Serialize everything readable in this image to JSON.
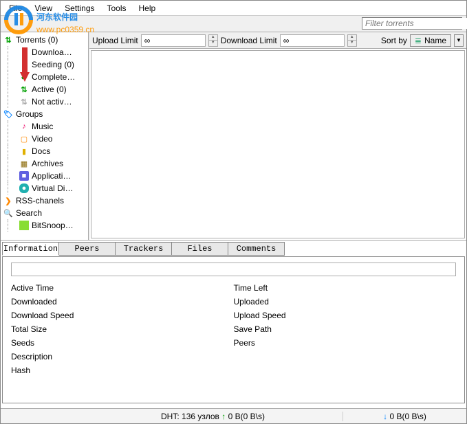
{
  "menu": {
    "file": "File",
    "view": "View",
    "settings": "Settings",
    "tools": "Tools",
    "help": "Help"
  },
  "search": {
    "placeholder": "Filter torrents"
  },
  "limits": {
    "upload_label": "Upload Limit",
    "upload_value": "∞",
    "download_label": "Download Limit",
    "download_value": "∞",
    "sort_label": "Sort by",
    "sort_value": "Name"
  },
  "sidebar": {
    "torrents": {
      "label": "Torrents (0)"
    },
    "torrents_children": [
      {
        "label": "Downloa…",
        "icon": "download"
      },
      {
        "label": "Seeding (0)",
        "icon": "seed"
      },
      {
        "label": "Complete…",
        "icon": "check"
      },
      {
        "label": "Active (0)",
        "icon": "active"
      },
      {
        "label": "Not activ…",
        "icon": "inactive"
      }
    ],
    "groups": {
      "label": "Groups"
    },
    "groups_children": [
      {
        "label": "Music",
        "icon": "music"
      },
      {
        "label": "Video",
        "icon": "video"
      },
      {
        "label": "Docs",
        "icon": "docs"
      },
      {
        "label": "Archives",
        "icon": "archive"
      },
      {
        "label": "Applicati…",
        "icon": "app"
      },
      {
        "label": "Virtual Di…",
        "icon": "disc"
      }
    ],
    "rss": {
      "label": "RSS-chanels"
    },
    "search": {
      "label": "Search"
    },
    "search_children": [
      {
        "label": "BitSnoop…",
        "icon": "site"
      }
    ]
  },
  "tabs": {
    "information": "Information",
    "peers": "Peers",
    "trackers": "Trackers",
    "files": "Files",
    "comments": "Comments"
  },
  "info": {
    "left": [
      "Active Time",
      "Downloaded",
      "Download Speed",
      "Total Size",
      "Seeds",
      "Description",
      "Hash"
    ],
    "right": [
      "Time Left",
      "Uploaded",
      "Upload Speed",
      "Save Path",
      "Peers"
    ]
  },
  "status": {
    "dht": "DHT: 136 узлов",
    "up": "0 B(0 B\\s)",
    "down": "0 B(0 B\\s)"
  },
  "watermark": {
    "line1": "河东软件园",
    "line2": "www.pc0359.cn"
  }
}
